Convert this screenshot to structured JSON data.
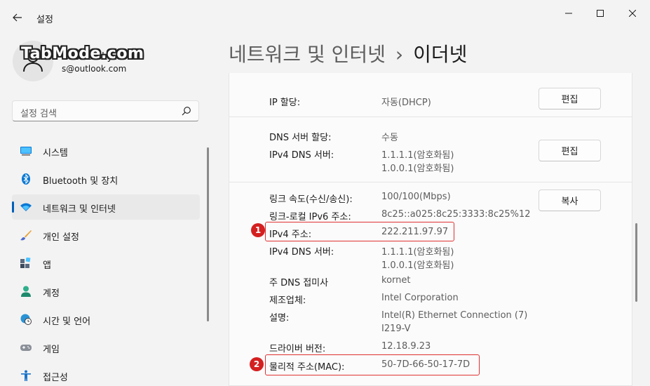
{
  "window": {
    "title": "설정"
  },
  "user": {
    "name": "Castle Sky",
    "email": "s@outlook.com",
    "watermark": "TabMode.com"
  },
  "search": {
    "placeholder": "설정 검색"
  },
  "nav": {
    "items": [
      {
        "label": "시스템",
        "icon": "monitor-icon"
      },
      {
        "label": "Bluetooth 및 장치",
        "icon": "bluetooth-icon"
      },
      {
        "label": "네트워크 및 인터넷",
        "icon": "wifi-icon",
        "selected": true
      },
      {
        "label": "개인 설정",
        "icon": "brush-icon"
      },
      {
        "label": "앱",
        "icon": "apps-icon"
      },
      {
        "label": "계정",
        "icon": "person-icon"
      },
      {
        "label": "시간 및 언어",
        "icon": "globe-clock-icon"
      },
      {
        "label": "게임",
        "icon": "gamepad-icon"
      },
      {
        "label": "접근성",
        "icon": "accessibility-icon"
      }
    ]
  },
  "header": {
    "parent": "네트워크 및 인터넷",
    "separator": "›",
    "current": "이더넷"
  },
  "details": {
    "ip_assignment": {
      "label": "IP 할당:",
      "value": "자동(DHCP)",
      "button": "편집"
    },
    "dns_assignment": {
      "label": "DNS 서버 할당:",
      "value": "수동"
    },
    "ipv4_dns_1": {
      "label": "IPv4 DNS 서버:",
      "value1": "1.1.1.1(암호화됨)",
      "value2": "1.0.0.1(암호화됨)",
      "button": "편집"
    },
    "link_speed": {
      "label": "링크 속도(수신/송신):",
      "value": "100/100(Mbps)",
      "button": "복사"
    },
    "link_local_ipv6": {
      "label": "링크-로컬 IPv6 주소:",
      "value": "8c25::a025:8c25:3333:8c25%12"
    },
    "ipv4_address": {
      "label": "IPv4 주소:",
      "value": "222.211.97.97"
    },
    "ipv4_dns_2": {
      "label": "IPv4 DNS 서버:",
      "value1": "1.1.1.1(암호화됨)",
      "value2": "1.0.0.1(암호화됨)"
    },
    "primary_dns_suffix": {
      "label": "주 DNS 접미사",
      "value": "kornet"
    },
    "manufacturer": {
      "label": "제조업체:",
      "value": "Intel Corporation"
    },
    "description": {
      "label": "설명:",
      "value1": "Intel(R) Ethernet Connection (7)",
      "value2": "I219-V"
    },
    "driver_version": {
      "label": "드라이버 버전:",
      "value": "12.18.9.23"
    },
    "mac_address": {
      "label": "물리적 주소(MAC):",
      "value": "50-7D-66-50-17-7D"
    }
  },
  "annotations": {
    "badge1": "1",
    "badge2": "2"
  },
  "colors": {
    "accent": "#005fb8",
    "highlight_red": "#e03030"
  }
}
